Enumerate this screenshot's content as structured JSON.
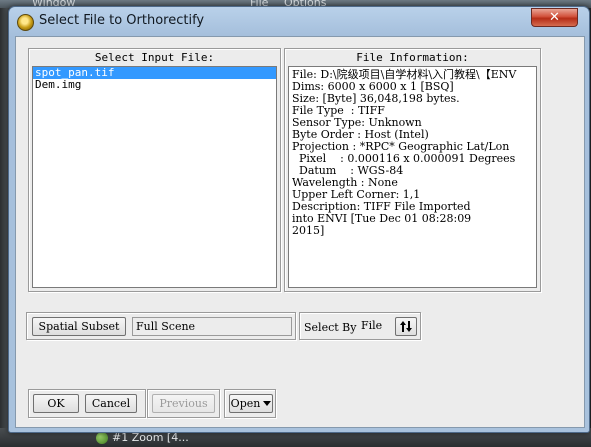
{
  "background": {
    "menu_items": [
      "Window",
      "File",
      "Options"
    ],
    "task_item": "#1 Zoom [4..."
  },
  "window": {
    "title": "Select File to Orthorectify",
    "close_label": "✕"
  },
  "input_panel": {
    "title": "Select Input File:",
    "files": [
      {
        "name": "spot_pan.tif",
        "selected": true
      },
      {
        "name": "Dem.img",
        "selected": false
      }
    ]
  },
  "info_panel": {
    "title": "File Information:",
    "lines": [
      "File: D:\\院级项目\\自学材料\\入门教程\\【ENV",
      "Dims: 6000 x 6000 x 1 [BSQ]",
      "Size: [Byte] 36,048,198 bytes.",
      "File Type  : TIFF",
      "Sensor Type: Unknown",
      "Byte Order : Host (Intel)",
      "Projection : *RPC* Geographic Lat/Lon",
      "  Pixel    : 0.000116 x 0.000091 Degrees",
      "  Datum    : WGS-84",
      "Wavelength : None",
      "Upper Left Corner: 1,1",
      "Description: TIFF File Imported",
      "into ENVI [Tue Dec 01 08:28:09",
      "2015]"
    ]
  },
  "subset": {
    "button_label": "Spatial Subset",
    "value": "Full Scene"
  },
  "select_by": {
    "label": "Select By",
    "value": "File",
    "toggle_icon": "sort-arrows-icon"
  },
  "actions": {
    "ok": "OK",
    "cancel": "Cancel",
    "previous": "Previous",
    "open": "Open"
  }
}
